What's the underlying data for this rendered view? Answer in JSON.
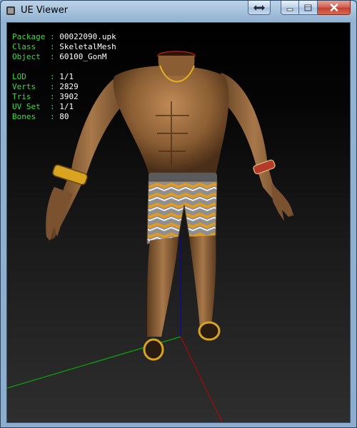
{
  "window": {
    "title": "UE Viewer"
  },
  "controls": {
    "fullscreen_icon": "double-arrow-icon",
    "minimize_icon": "minimize-icon",
    "maximize_icon": "maximize-icon",
    "close_icon": "close-icon"
  },
  "info": {
    "package_label": "Package",
    "package_value": "00022090.upk",
    "class_label": "Class",
    "class_value": "SkeletalMesh",
    "object_label": "Object",
    "object_value": "60100_GonM",
    "lod_label": "LOD",
    "lod_value": "1/1",
    "verts_label": "Verts",
    "verts_value": "2829",
    "tris_label": "Tris",
    "tris_value": "3902",
    "uvset_label": "UV Set",
    "uvset_value": "1/1",
    "bones_label": "Bones",
    "bones_value": "80"
  },
  "colors": {
    "label": "#3ddc3d",
    "value": "#ffffff",
    "axis_x": "#c00000",
    "axis_y": "#00c000",
    "axis_z": "#0000d0"
  }
}
